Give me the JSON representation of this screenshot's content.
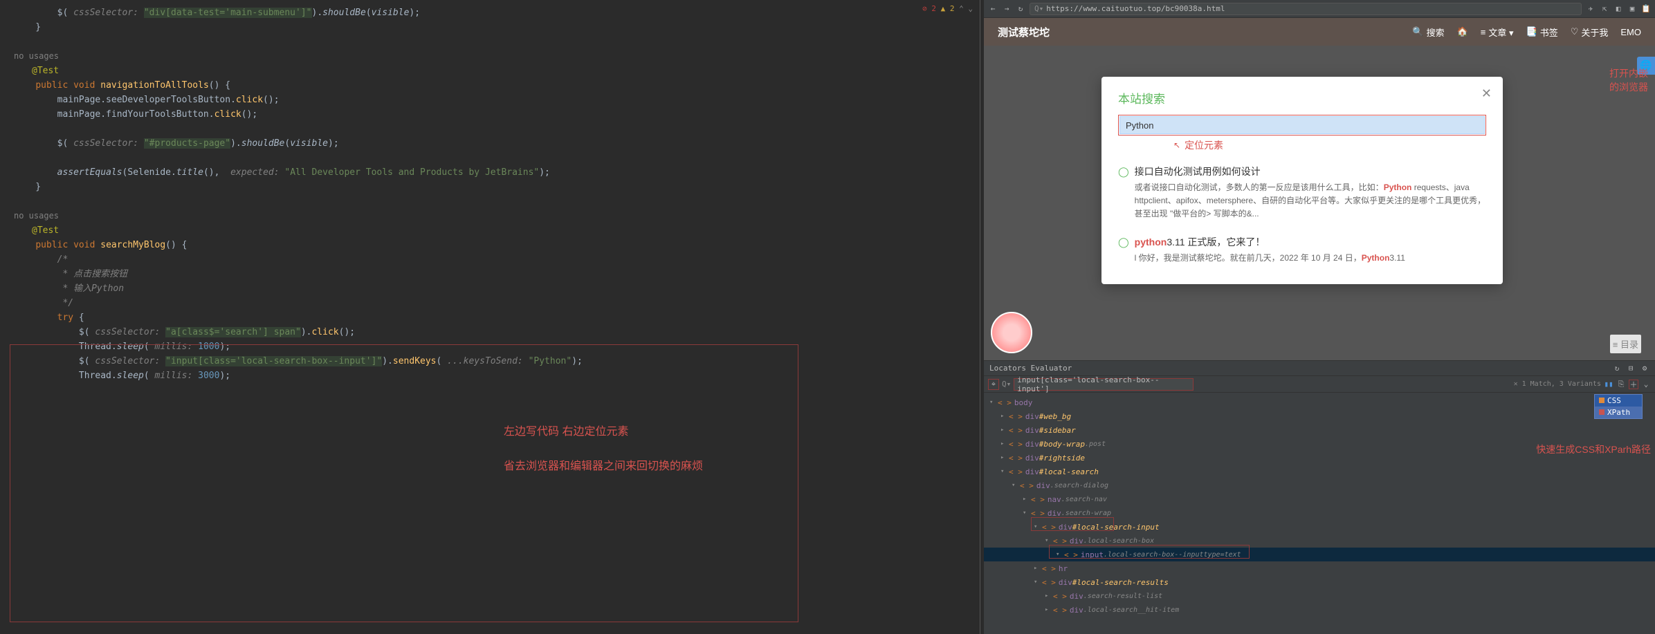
{
  "status": {
    "errors": "2",
    "warnings": "2"
  },
  "code": {
    "line1_pre": "        $(",
    "line1_param": " cssSelector: ",
    "line1_str": "\"div[data-test='main-submenu']\"",
    "line1_post": ").",
    "line1_m": "shouldBe",
    "line1_arg": "visible",
    "line1_end": ");",
    "brace": "    }",
    "usages": "no usages",
    "anno": "@Test",
    "sig_pre": "    ",
    "kw_public": "public",
    "kw_void": "void",
    "m_nav": "navigationToAllTools",
    "sig_post": "() {",
    "mp1": "        mainPage.seeDeveloperToolsButton.",
    "mp_click": "click",
    "mp_end": "();",
    "mp2": "        mainPage.findYourToolsButton.",
    "css2_pre": "        $(",
    "css2_param": " cssSelector: ",
    "css2_str": "\"#products-page\"",
    "css2_post": ").",
    "css2_m": "shouldBe",
    "css2_arg": "visible",
    "css2_end": ");",
    "ae_pre": "        ",
    "ae_m": "assertEquals",
    "ae_mid": "(Selenide.",
    "ae_title": "title",
    "ae_mid2": "(), ",
    "ae_param": " expected: ",
    "ae_str": "\"All Developer Tools and Products by JetBrains\"",
    "ae_end": ");",
    "m_search": "searchMyBlog",
    "cmt1": "        /*",
    "cmt2": "         * 点击搜索按钮",
    "cmt3": "         * 输入Python",
    "cmt4": "         */",
    "try_pre": "        ",
    "kw_try": "try",
    "try_post": " {",
    "s1_pre": "            $(",
    "s1_param": " cssSelector: ",
    "s1_str": "\"a[class$='search'] span\"",
    "s1_post": ").",
    "s1_m": "click",
    "s1_end": "();",
    "sleep1_pre": "            Thread.",
    "sleep_m": "sleep",
    "sleep1_mid": "(",
    "sleep_param": " millis: ",
    "sleep1_num": "1000",
    "sleep1_end": ");",
    "s2_pre": "            $(",
    "s2_param": " cssSelector: ",
    "s2_str": "\"input[class='local-search-box--input']\"",
    "s2_post": ").",
    "s2_m": "sendKeys",
    "s2_mid": "(",
    "s2_kparam": " ...keysToSend: ",
    "s2_kstr": "\"Python\"",
    "s2_end": ");",
    "sleep2_num": "3000"
  },
  "notes": {
    "left1": "左边写代码 右边定位元素",
    "left2": "省去浏览器和编辑器之间来回切换的麻烦",
    "right1a": "打开内嵌",
    "right1b": "的浏览器",
    "right2": "快速生成CSS和XParh路径",
    "dingwei": "定位元素"
  },
  "browser": {
    "url": "https://www.caituotuo.top/bc90038a.html",
    "url_prefix": "Q▾"
  },
  "preview": {
    "brand": "测试蔡坨坨",
    "nav_search": "搜索",
    "nav_home": "",
    "nav_category": "文章 ▾",
    "nav_bookmark": "书签",
    "nav_about": "关于我",
    "nav_emo": "EMO",
    "search_title": "本站搜索",
    "search_value": "Python",
    "result1_title": "接口自动化测试用例如何设计",
    "result1_desc_pre": "或者说接口自动化测试，多数人的第一反应是该用什么工具，比如：",
    "result1_kw": "Pytho",
    "result1_kw2": "n",
    "result1_desc_mid": " requests、java httpclient、apifox、metersphere、自研的自动化平台等。大家似乎更关注的是哪个工具更优秀，甚至出现 \"做平台的> 写脚本的&...",
    "result2_title_pre": "",
    "result2_kw": "python",
    "result2_title_post": "3.11 正式版，它来了！",
    "result2_desc_pre": "l 你好，我是测试蔡坨坨。就在前几天，2022 年 10 月 24 日，",
    "result2_kw2": "Python",
    "result2_desc_post": "3.11",
    "toc": "目录"
  },
  "locators": {
    "title": "Locators Evaluator",
    "query": "input[class='local-search-box--input']",
    "match": "1 Match, 3 Variants",
    "popup_css": "CSS",
    "popup_xpath": "XPath",
    "tree": [
      {
        "indent": 0,
        "chevron": "▾",
        "tag": "body",
        "label": ""
      },
      {
        "indent": 1,
        "chevron": "▸",
        "tag": "div",
        "id": "#web_bg"
      },
      {
        "indent": 1,
        "chevron": "▸",
        "tag": "div",
        "id": "#sidebar"
      },
      {
        "indent": 1,
        "chevron": "▸",
        "tag": "div",
        "id": "#body-wrap",
        "cls": ".post"
      },
      {
        "indent": 1,
        "chevron": "▸",
        "tag": "div",
        "id": "#rightside"
      },
      {
        "indent": 1,
        "chevron": "▾",
        "tag": "div",
        "id": "#local-search"
      },
      {
        "indent": 2,
        "chevron": "▾",
        "tag": "div",
        "cls": ".search-dialog"
      },
      {
        "indent": 3,
        "chevron": "▸",
        "tag": "nav",
        "cls": ".search-nav"
      },
      {
        "indent": 3,
        "chevron": "▾",
        "tag": "div",
        "cls": ".search-wrap"
      },
      {
        "indent": 4,
        "chevron": "▾",
        "tag": "div",
        "id": "#local-search-input"
      },
      {
        "indent": 5,
        "chevron": "▾",
        "tag": "div",
        "cls": ".local-search-box"
      },
      {
        "indent": 6,
        "chevron": "▾",
        "tag": "input",
        "cls": ".local-search-box--input",
        "attr": "type=text",
        "selected": true
      },
      {
        "indent": 4,
        "chevron": "▸",
        "tag": "hr",
        "label": ""
      },
      {
        "indent": 4,
        "chevron": "▾",
        "tag": "div",
        "id": "#local-search-results"
      },
      {
        "indent": 5,
        "chevron": "▸",
        "tag": "div",
        "cls": ".search-result-list"
      },
      {
        "indent": 5,
        "chevron": "▸",
        "tag": "div",
        "cls": ".local-search__hit-item"
      }
    ]
  }
}
